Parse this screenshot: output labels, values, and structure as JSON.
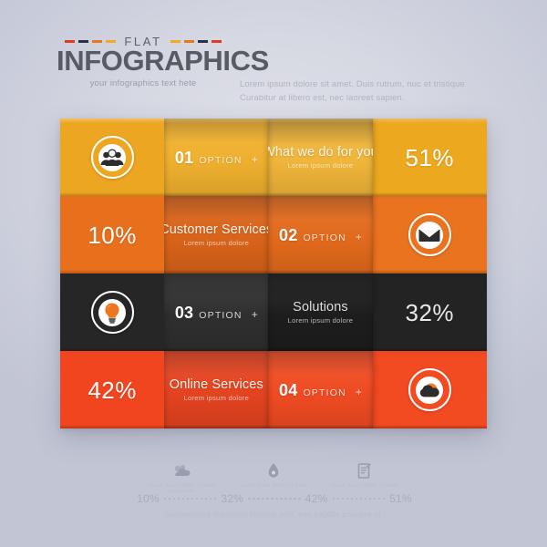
{
  "header": {
    "eyebrow": "FLAT",
    "title": "INFOGRAPHICS",
    "subtitle": "your infographics text hete",
    "dashes_left": [
      "#e03a20",
      "#2b3247",
      "#e87722",
      "#efab24"
    ],
    "dashes_right": [
      "#efab24",
      "#e87722",
      "#2b3247",
      "#e03a20"
    ],
    "lorem_line1": "Lorem ipsum dolore sit amet. Duis rutrum, nuc et tristique",
    "lorem_line2": "Curabitur at libero est, nec laoreet sapien."
  },
  "panel": {
    "rows": [
      {
        "id": "row-01",
        "color": "#eda621",
        "cells": [
          {
            "kind": "icon",
            "icon": "group-people-icon"
          },
          {
            "kind": "option",
            "number": "01",
            "word": "OPTION",
            "plus": "+"
          },
          {
            "kind": "title",
            "main": "What we do for you",
            "sub": "Lorem ipsum dolore"
          },
          {
            "kind": "stat",
            "value": "51%"
          }
        ]
      },
      {
        "id": "row-02",
        "color": "#e86f1c",
        "cells": [
          {
            "kind": "stat",
            "value": "10%"
          },
          {
            "kind": "title",
            "main": "Customer Services",
            "sub": "Lorem ipsum dolore"
          },
          {
            "kind": "option",
            "number": "02",
            "word": "OPTION",
            "plus": "+"
          },
          {
            "kind": "icon",
            "icon": "envelope-mail-icon"
          }
        ]
      },
      {
        "id": "row-03",
        "color": "#262626",
        "cells": [
          {
            "kind": "icon",
            "icon": "lightbulb-idea-icon"
          },
          {
            "kind": "option",
            "number": "03",
            "word": "OPTION",
            "plus": "+"
          },
          {
            "kind": "title",
            "main": "Solutions",
            "sub": "Lorem ipsum dolore"
          },
          {
            "kind": "stat",
            "value": "32%"
          }
        ]
      },
      {
        "id": "row-04",
        "color": "#f1451f",
        "cells": [
          {
            "kind": "stat",
            "value": "42%"
          },
          {
            "kind": "title",
            "main": "Online Services",
            "sub": "Lorem ipsum dolore"
          },
          {
            "kind": "option",
            "number": "04",
            "word": "OPTION",
            "plus": "+"
          },
          {
            "kind": "icon",
            "icon": "cloud-weather-icon"
          }
        ]
      }
    ]
  },
  "footer": {
    "icons": [
      {
        "icon": "clouds-icon",
        "label": "Lorem ipsum dolore\nsit amet consectetur"
      },
      {
        "icon": "droplet-icon",
        "label": "Lorem ipsum dolore\nsit amet"
      },
      {
        "icon": "document-edit-icon",
        "label": "Lorem ipsum dolore\nsit amet"
      }
    ],
    "scale": [
      "10%",
      "32%",
      "42%",
      "51%"
    ],
    "lorem": "Suspendisse dignissim lobortis velit, nec sagittis posuere id."
  },
  "chart_data": {
    "type": "bar",
    "title": "FLAT INFOGRAPHICS",
    "categories": [
      "10%",
      "32%",
      "42%",
      "51%"
    ],
    "values": [
      10,
      32,
      42,
      51
    ],
    "series": [
      {
        "name": "Customer Services",
        "value": 10,
        "option": "02",
        "color": "#e86f1c"
      },
      {
        "name": "Solutions",
        "value": 32,
        "option": "03",
        "color": "#262626"
      },
      {
        "name": "Online Services",
        "value": 42,
        "option": "04",
        "color": "#f1451f"
      },
      {
        "name": "What we do for you",
        "value": 51,
        "option": "01",
        "color": "#eda621"
      }
    ],
    "xlabel": "",
    "ylabel": "",
    "ylim": [
      0,
      100
    ],
    "legend": "bottom",
    "grid": false
  }
}
